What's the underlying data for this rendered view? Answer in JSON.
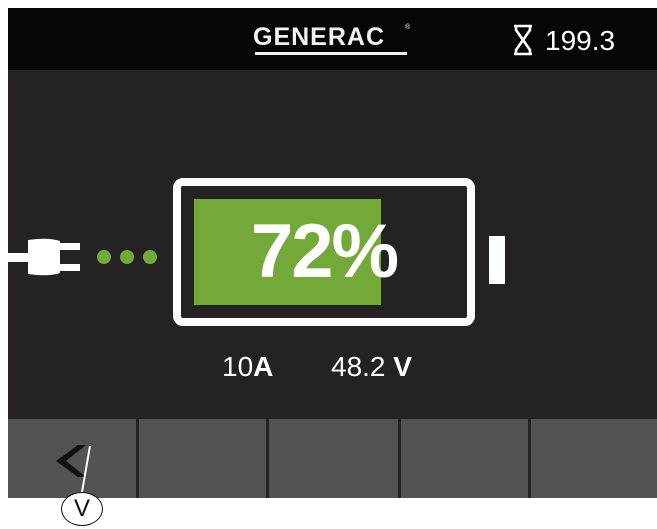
{
  "header": {
    "brand": "GENERAC",
    "brand_mark": "®",
    "runtime_value": "199.3",
    "runtime_icon": "hourglass-icon"
  },
  "battery": {
    "percent_label": "72%",
    "charge_fraction": 0.72,
    "charging_icon": "plug-icon"
  },
  "readings": {
    "current_value": "10",
    "current_unit": "A",
    "voltage_value": "48.2",
    "voltage_unit": "V"
  },
  "softkeys": {
    "back_icon": "chevron-left-icon"
  },
  "callout": {
    "label": "V"
  },
  "colors": {
    "screen_background": "#242222",
    "header_background": "#060606",
    "battery_fill": "#74a93a",
    "softkey_background": "#535353",
    "foreground": "#ffffff"
  }
}
